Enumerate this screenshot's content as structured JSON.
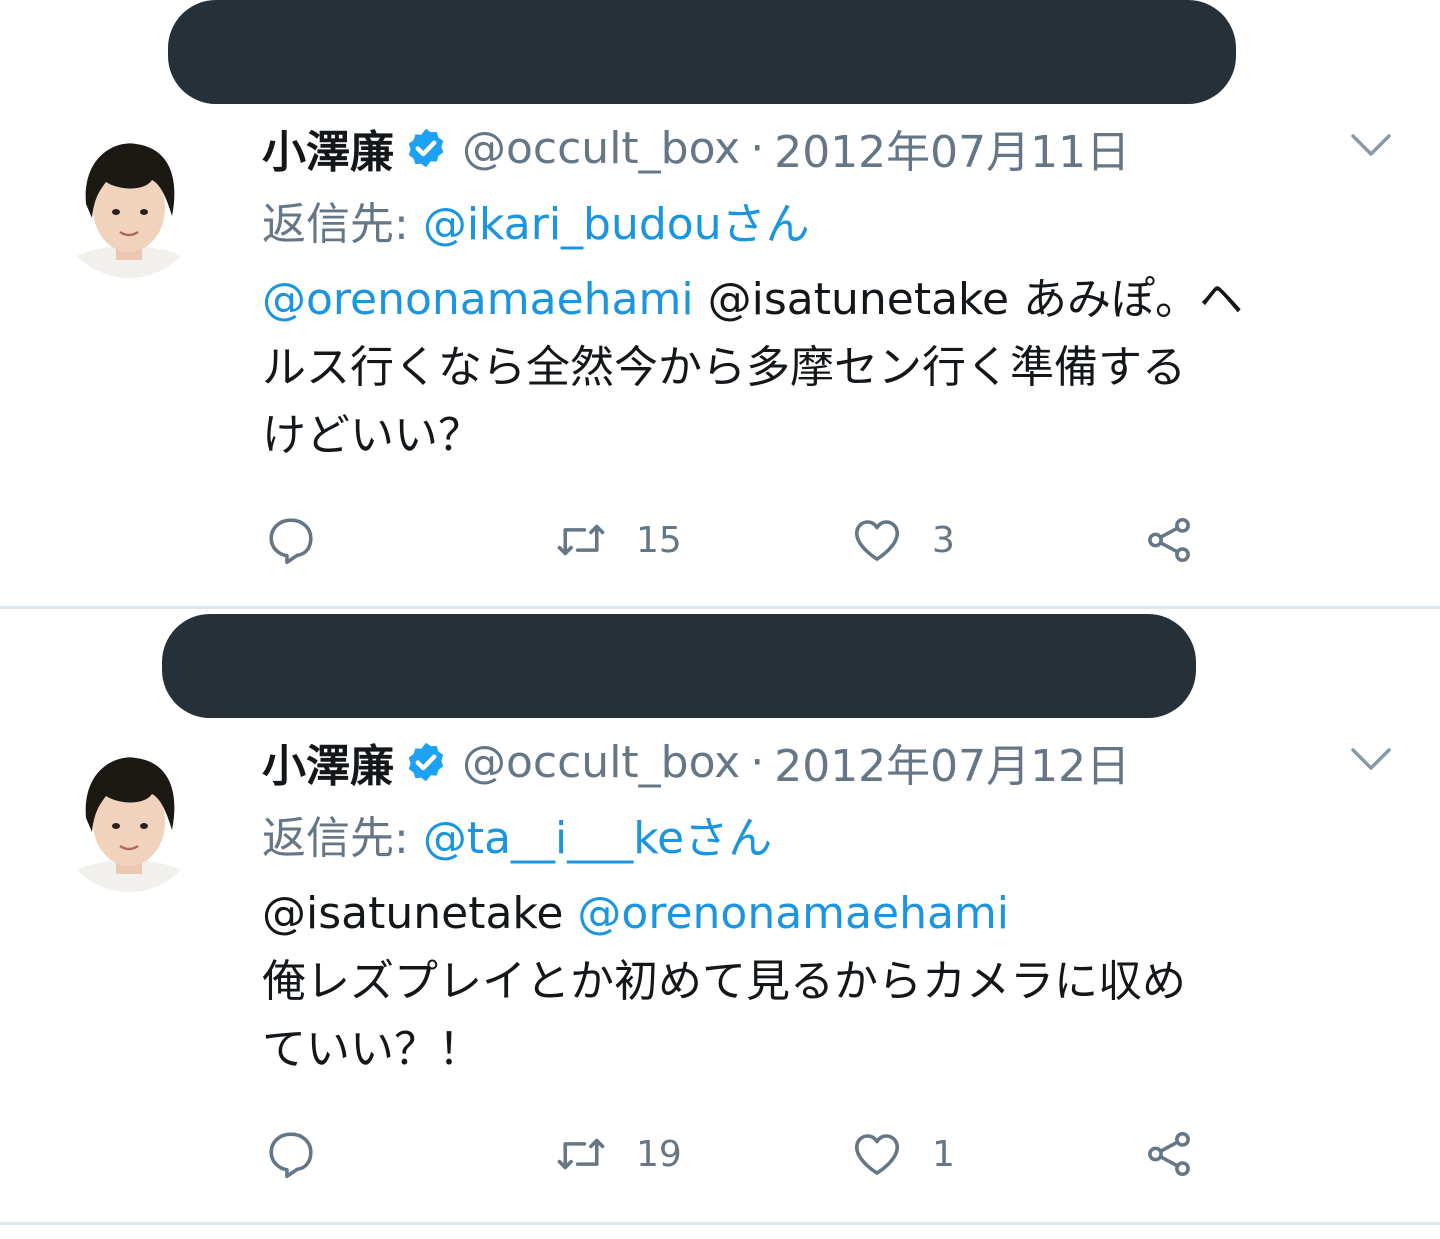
{
  "tweets": [
    {
      "name": "小澤廉",
      "handle": "@occult_box",
      "separator": "·",
      "date": "2012年07月11日",
      "reply_label": "返信先:",
      "reply_to": "@ikari_budouさん",
      "mention_1": "@orenonamaehami",
      "mention_2": "@isatunetake",
      "line_1_text": "あみぽ。ヘ",
      "line_2": "ルス行くなら全然今から多摩セン行く準備する",
      "line_3": "けどいい？",
      "retweets": "15",
      "likes": "3"
    },
    {
      "name": "小澤廉",
      "handle": "@occult_box",
      "separator": "·",
      "date": "2012年07月12日",
      "reply_label": "返信先:",
      "reply_to": "@ta__i___keさん",
      "mention_1": "@isatunetake",
      "mention_2": "@orenonamaehami",
      "line_2": "俺レズプレイとか初めて見るからカメラに収め",
      "line_3": "ていい？！",
      "retweets": "19",
      "likes": "1"
    }
  ],
  "icons": {
    "verified": "verified-badge-icon",
    "chevron": "chevron-down-icon",
    "reply": "reply-icon",
    "retweet": "retweet-icon",
    "like": "heart-icon",
    "share": "share-icon"
  },
  "colors": {
    "link": "#1b95e0",
    "secondary_text": "#657786",
    "redaction": "#263038",
    "divider": "#e1e8ed"
  }
}
